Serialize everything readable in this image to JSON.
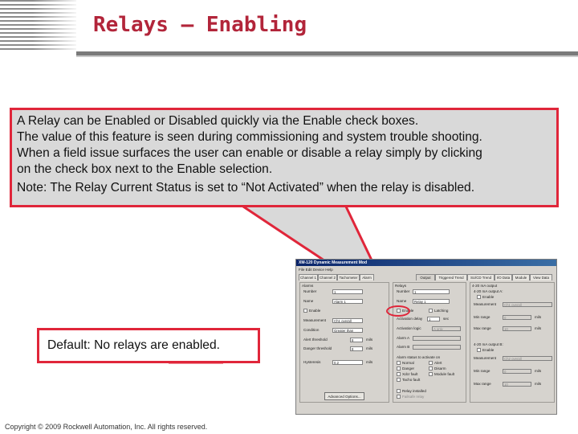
{
  "slide": {
    "title": "Relays – Enabling",
    "callout": [
      "A Relay can be Enabled or Disabled quickly via the Enable check boxes.",
      "The value of this feature is seen during commissioning and system trouble shooting.",
      "When a field issue surfaces the user can enable or disable a relay simply by clicking",
      "on the check box next to the Enable selection.",
      "Note: The Relay Current Status is set to “Not Activated” when the relay is disabled."
    ],
    "default_note": "Default:  No relays are enabled.",
    "copyright": "Copyright © 2009 Rockwell Automation, Inc. All rights reserved."
  },
  "dialog": {
    "title": "XM-120 Dynamic Measurement Mod",
    "menu": "File  Edit  Device  Help",
    "tabs": [
      "Channel 1",
      "Channel 2",
      "Tachometer",
      "Alarm",
      "Output",
      "Triggered Trend",
      "SU/CD Trend",
      "I/O Data",
      "Module",
      "View Data"
    ],
    "alarms": {
      "group": "Alarms",
      "number_label": "Number",
      "number_value": "1",
      "name_label": "Name",
      "name_value": "Alarm 1",
      "enable_label": "Enable",
      "measurement_label": "Measurement",
      "measurement_value": "Ch1 overall",
      "condition_label": "Condition",
      "condition_value": "Greater than",
      "alert_threshold_label": "Alert threshold",
      "alert_threshold_value": "8",
      "danger_threshold_label": "Danger threshold",
      "danger_threshold_value": "8",
      "hysteresis_label": "Hysteresis",
      "hysteresis_value": "0.2",
      "unit": "mils",
      "advanced_button": "Advanced Options..."
    },
    "relay": {
      "group": "Relays",
      "number_label": "Number",
      "number_value": "1",
      "name_label": "Name",
      "name_value": "Relay 1",
      "enable_label": "Enable",
      "latching_label": "Latching",
      "activation_delay_label": "Activation delay",
      "activation_delay_value": "1",
      "activation_delay_unit": "sec",
      "activation_logic_label": "Activation logic",
      "activation_logic_value": "A only",
      "alarm_a_label": "Alarm A",
      "alarm_b_label": "Alarm B",
      "alarm_status_label": "Alarm status to activate on",
      "normal_label": "Normal",
      "alert_label": "Alert",
      "danger_label": "Danger",
      "disarm_label": "Disarm",
      "xdcr_fault_label": "Xdcr fault",
      "module_fault_label": "Module fault",
      "tacho_fault_label": "Tacho fault",
      "relay_installed_label": "Relay installed",
      "failsafe_label": "Failsafe relay"
    },
    "output420": {
      "a_group": "4-20 mA output",
      "a_label": "4-20 mA output A:",
      "enable_label": "Enable",
      "measurement_label": "Measurement",
      "measurement_a_value": "Ch1 overall",
      "min_range_label": "Min range",
      "min_range_value": "0",
      "max_range_label": "Max range",
      "max_range_value": "10",
      "b_label": "4-20 mA output B:",
      "measurement_b_value": "Ch2 overall",
      "unit": "mils"
    }
  },
  "colors": {
    "title": "#b2253a",
    "callout_border": "#e0263a",
    "callout_bg": "#d9d9d9",
    "dialog_bg": "#d6d3ce"
  }
}
